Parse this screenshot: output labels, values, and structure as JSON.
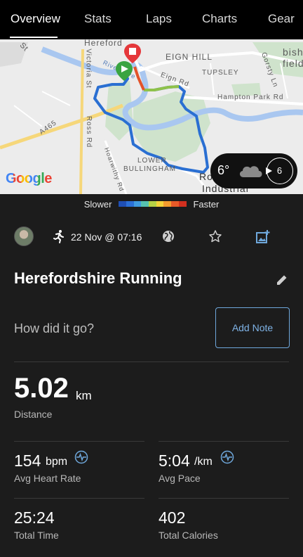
{
  "tabs": [
    {
      "label": "Overview",
      "active": true
    },
    {
      "label": "Stats",
      "active": false
    },
    {
      "label": "Laps",
      "active": false
    },
    {
      "label": "Charts",
      "active": false
    },
    {
      "label": "Gear",
      "active": false
    }
  ],
  "map": {
    "labels": [
      "St",
      "Hereford",
      "EIGN HILL",
      "bish",
      "field",
      "TUPSLEY",
      "Gorsty Ln",
      "Victoria St",
      "River Wye",
      "Eign Rd",
      "Hampton Park Rd",
      "A465",
      "Ross Rd",
      "Hoarwithy Rd",
      "LOWER",
      "BULLINGHAM",
      "Ro",
      "Industrial"
    ],
    "attribution": "Google",
    "weather": {
      "temperature": "6°",
      "condition_icon": "cloud-icon",
      "wind_speed": "6"
    }
  },
  "pace_legend": {
    "slower_label": "Slower",
    "faster_label": "Faster",
    "colors": [
      "#1f4fb5",
      "#2b6fd6",
      "#3f9be0",
      "#56c2b0",
      "#b5d145",
      "#f3d23a",
      "#f39b2e",
      "#e75a28",
      "#d2301f"
    ]
  },
  "activity": {
    "type_icon": "runner-icon",
    "datetime": "22 Nov @ 07:16",
    "title": "Herefordshire Running",
    "note_prompt": "How did it go?",
    "add_note_label": "Add Note"
  },
  "stats": {
    "distance": {
      "value": "5.02",
      "unit": "km",
      "label": "Distance"
    },
    "heart_rate": {
      "value": "154",
      "unit": "bpm",
      "label": "Avg Heart Rate"
    },
    "pace": {
      "value": "5:04",
      "unit": "/km",
      "label": "Avg Pace"
    },
    "time": {
      "value": "25:24",
      "label": "Total Time"
    },
    "calories": {
      "value": "402",
      "label": "Total Calories"
    }
  },
  "colors": {
    "accent": "#6fa8dc",
    "background": "#1c1c1c",
    "tab_bar": "#000000"
  }
}
